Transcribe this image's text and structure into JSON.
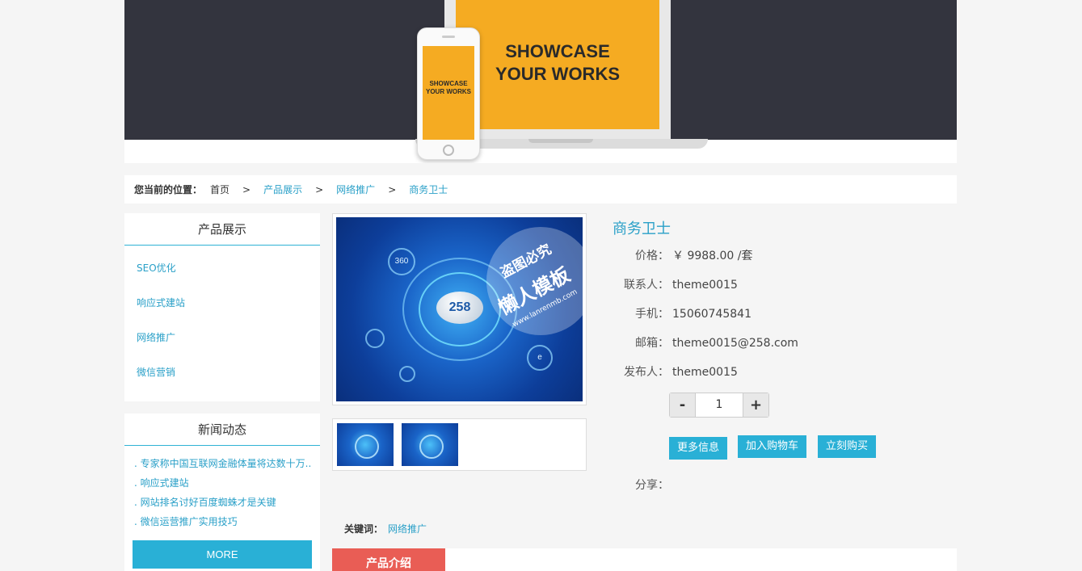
{
  "banner": {
    "big_text": "SHOWCASE\nYOUR WORKS",
    "small_text": "SHOWCASE\nYOUR WORKS"
  },
  "breadcrumb": {
    "label": "您当前的位置：",
    "home": "首页",
    "sep": ">",
    "items": [
      "产品展示",
      "网络推广",
      "商务卫士"
    ]
  },
  "sidebar": {
    "products": {
      "title": "产品展示",
      "items": [
        "SEO优化",
        "响应式建站",
        "网络推广",
        "微信营销"
      ]
    },
    "news": {
      "title": "新闻动态",
      "items": [
        "专家称中国互联网金融体量将达数十万..",
        "响应式建站",
        "网站排名讨好百度蜘蛛才是关键",
        "微信运营推广实用技巧"
      ],
      "more": "MORE"
    }
  },
  "image": {
    "logo": "258",
    "watermark": {
      "line1": "盗图必究",
      "line2": "懒人模板",
      "line3": "www.lanrenmb.com"
    },
    "bubbles": [
      "360",
      "e"
    ]
  },
  "product": {
    "title": "商务卫士",
    "fields": [
      {
        "k": "价格：",
        "v": "￥ 9988.00 /套"
      },
      {
        "k": "联系人：",
        "v": "theme0015"
      },
      {
        "k": "手机：",
        "v": "15060745841"
      },
      {
        "k": "邮箱：",
        "v": "theme0015@258.com"
      },
      {
        "k": "发布人：",
        "v": "theme0015"
      }
    ],
    "qty": {
      "minus": "-",
      "value": "1",
      "plus": "+"
    },
    "buttons": {
      "more": "更多信息",
      "cart": "加入购物车",
      "buy": "立刻购买"
    },
    "share_label": "分享："
  },
  "keywords": {
    "label": "关键词：",
    "value": "网络推广"
  },
  "intro_tab": "产品介绍"
}
